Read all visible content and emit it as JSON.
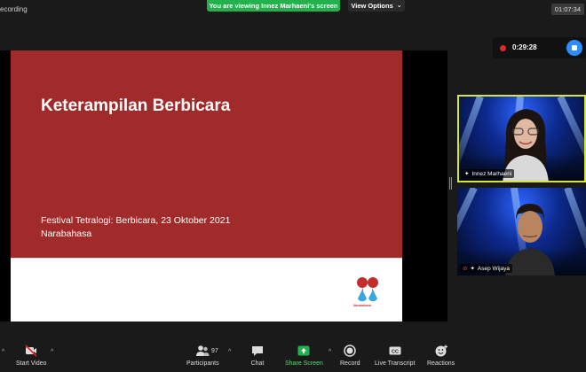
{
  "top": {
    "recording_label": "ecording",
    "viewing_banner": "You are viewing Innez Marhaeni's screen",
    "view_options": "View Options",
    "view_options_caret": "⌄",
    "clock": "01:07:34"
  },
  "recording": {
    "elapsed": "0:29:28"
  },
  "slide": {
    "title": "Keterampilan Berbicara",
    "subtitle_line1": "Festival Tetralogi: Berbicara, 23 Oktober 2021",
    "subtitle_line2": "Narabahasa",
    "logo_text": "Narabahasa"
  },
  "participants": [
    {
      "name": "Innez Marhaeni",
      "active_speaker": true
    },
    {
      "name": "Asep Wijaya",
      "active_speaker": false
    }
  ],
  "toolbar": {
    "start_video": "Start Video",
    "participants": "Participants",
    "participants_count": "97",
    "chat": "Chat",
    "share_screen": "Share Screen",
    "record": "Record",
    "live_transcript": "Live Transcript",
    "reactions": "Reactions",
    "caret_glyph": "^"
  },
  "colors": {
    "banner_green": "#23b14d",
    "slide_red": "#a12a2a",
    "active_border": "#d8e634",
    "stop_blue": "#2d8cff",
    "record_red": "#e02828"
  }
}
